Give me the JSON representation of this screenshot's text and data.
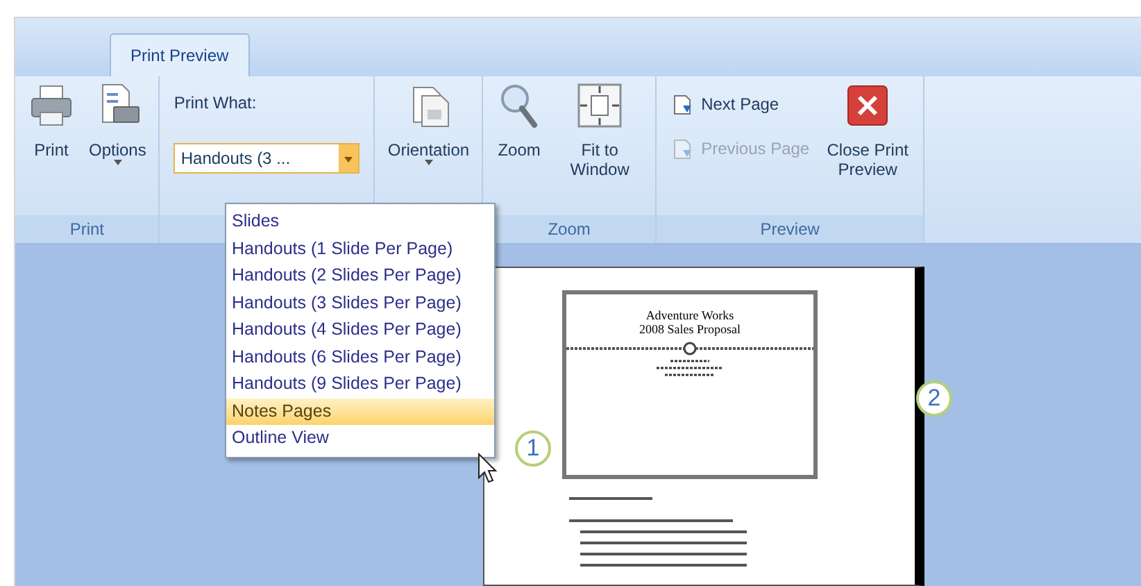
{
  "tabs": [
    {
      "label": "Print Preview",
      "selected": true
    }
  ],
  "groups": [
    {
      "label": "Print",
      "controls": [
        {
          "kind": "large",
          "label": "Print",
          "has_menu": false,
          "disabled": false
        },
        {
          "kind": "large",
          "label": "Options",
          "has_menu": true,
          "disabled": false
        }
      ]
    },
    {
      "controls": [
        {
          "kind": "combo",
          "label": "Print What:",
          "value": "Handouts (3 ...",
          "expanded": true
        }
      ]
    },
    {
      "controls": [
        {
          "kind": "large",
          "label": "Orientation",
          "has_menu": true,
          "disabled": false
        }
      ]
    },
    {
      "label": "Zoom",
      "controls": [
        {
          "kind": "large",
          "label": "Zoom",
          "has_menu": false,
          "disabled": false
        },
        {
          "kind": "large",
          "label": "Fit to Window",
          "has_menu": false,
          "disabled": false
        }
      ]
    },
    {
      "label": "Preview",
      "controls": [
        {
          "kind": "stack",
          "items": [
            {
              "label": "Next Page",
              "disabled": false
            },
            {
              "label": "Previous Page",
              "disabled": true
            }
          ]
        },
        {
          "kind": "large",
          "label": "Close Print Preview",
          "has_menu": false,
          "disabled": false
        }
      ]
    }
  ],
  "menu": {
    "items": [
      {
        "label": "Slides",
        "selected": false
      },
      {
        "label": "Handouts (1 Slide Per Page)",
        "selected": false
      },
      {
        "label": "Handouts (2 Slides Per Page)",
        "selected": false
      },
      {
        "label": "Handouts (3 Slides Per Page)",
        "selected": false
      },
      {
        "label": "Handouts (4 Slides Per Page)",
        "selected": false
      },
      {
        "label": "Handouts (6 Slides Per Page)",
        "selected": false
      },
      {
        "label": "Handouts (9 Slides Per Page)",
        "selected": false
      },
      {
        "label": "Notes Pages",
        "selected": true
      },
      {
        "label": "Outline View",
        "selected": false
      }
    ]
  },
  "slide": {
    "title_lines": [
      "Adventure Works",
      "2008 Sales Proposal"
    ]
  },
  "callouts": [
    "1",
    "2"
  ]
}
